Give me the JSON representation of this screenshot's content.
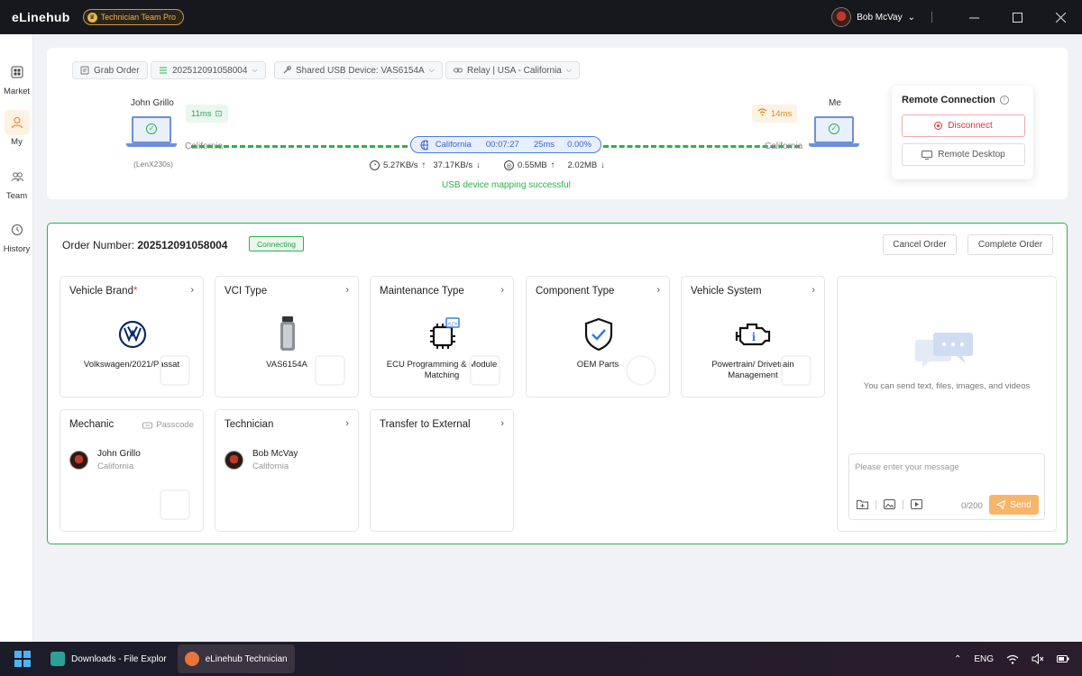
{
  "titlebar": {
    "brand": "eLinehub",
    "badge": "Technician Team Pro",
    "user_name": "Bob McVay"
  },
  "nav": {
    "items": [
      {
        "label": "Market",
        "icon": "grid-icon"
      },
      {
        "label": "My",
        "icon": "person-icon",
        "active": true
      },
      {
        "label": "Team",
        "icon": "team-icon"
      },
      {
        "label": "History",
        "icon": "clock-icon"
      }
    ]
  },
  "connection": {
    "grab_order": "Grab Order",
    "order_select": "202512091058004",
    "usb_device": "Shared USB Device: VAS6154A",
    "relay": "Relay | USA - California",
    "remote_name": "John Grillo",
    "remote_location": "California",
    "remote_device": "(LenX230s)",
    "remote_ping": "11ms",
    "me_name": "Me",
    "me_location": "California",
    "me_ping": "14ms",
    "relay_region": "California",
    "elapsed": "00:07:27",
    "latency": "25ms",
    "loss": "0.00%",
    "upload_speed": "5.27KB/s",
    "download_speed": "37.17KB/s",
    "upload_total": "0.55MB",
    "download_total": "2.02MB",
    "status_message": "USB device mapping successful",
    "colors": {
      "accent": "#2bb24c",
      "relay": "#4a7de3",
      "brand": "#e8b653"
    }
  },
  "remote": {
    "title": "Remote Connection",
    "disconnect": "Disconnect",
    "remote_desktop": "Remote Desktop"
  },
  "order": {
    "label": "Order Number: ",
    "number": "202512091058004",
    "status": "Connecting",
    "cancel": "Cancel Order",
    "complete": "Complete Order",
    "tiles": {
      "brand": {
        "title": "Vehicle Brand",
        "required": "*",
        "value": "Volkswagen/2021/Passat"
      },
      "vci": {
        "title": "VCI Type",
        "value": "VAS6154A"
      },
      "maintenance": {
        "title": "Maintenance Type",
        "value": "ECU Programming & Module Matching"
      },
      "component": {
        "title": "Component Type",
        "value": "OEM Parts"
      },
      "system": {
        "title": "Vehicle System",
        "value": "Powertrain/ Drivetrain Management"
      },
      "mechanic": {
        "title": "Mechanic",
        "passcode": "Passcode",
        "name": "John Grillo",
        "location": "California"
      },
      "technician": {
        "title": "Technician",
        "name": "Bob McVay",
        "location": "California"
      },
      "transfer": {
        "title": "Transfer to External"
      }
    }
  },
  "chat": {
    "hint": "You can send text, files, images, and videos",
    "placeholder": "Please enter your message",
    "counter": "0/200",
    "send": "Send"
  },
  "taskbar": {
    "apps": [
      {
        "label": "Downloads - File Explor"
      },
      {
        "label": "eLinehub Technician",
        "active": true
      }
    ],
    "lang": "ENG"
  }
}
